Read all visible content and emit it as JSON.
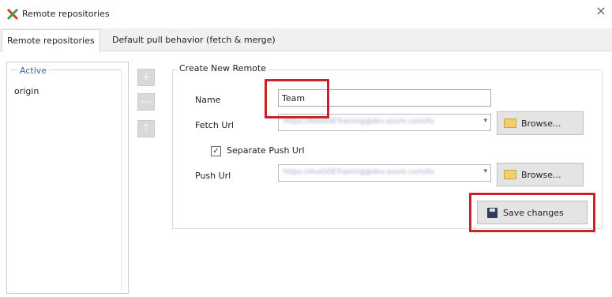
{
  "window": {
    "title": "Remote repositories",
    "close_glyph": "×",
    "icon": "git-extensions-icon"
  },
  "tabs": [
    {
      "label": "Remote repositories",
      "active": true
    },
    {
      "label": "Default pull behavior (fetch & merge)",
      "active": false
    }
  ],
  "left_panel": {
    "group_label": "Active",
    "items": [
      "origin"
    ]
  },
  "side_buttons": [
    {
      "glyph": "+",
      "icon": "add-icon"
    },
    {
      "glyph": "—",
      "icon": "remove-icon"
    },
    {
      "glyph": "⇡",
      "icon": "move-icon"
    }
  ],
  "create_remote": {
    "group_label": "Create New Remote",
    "name_label": "Name",
    "name_value": "Team",
    "fetch_label": "Fetch Url",
    "fetch_value": "https://AvaSDETraining@dev.azure.com/Av",
    "separate_push_label": "Separate Push Url",
    "separate_push_checked": true,
    "push_label": "Push Url",
    "push_value": "https://AvaSDETraining@dev.azure.com/Av",
    "browse_label": "Browse...",
    "save_label": "Save changes"
  },
  "colors": {
    "highlight": "#c8232c",
    "active_label": "#3a5fa0"
  }
}
